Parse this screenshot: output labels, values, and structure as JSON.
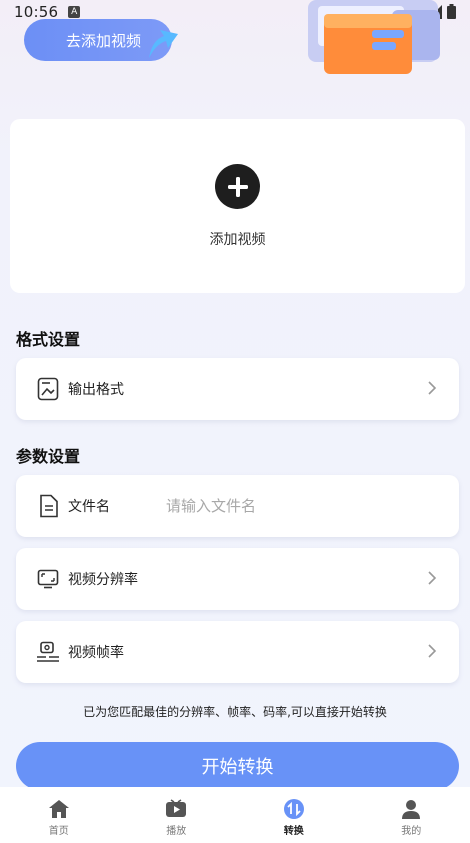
{
  "status_bar": {
    "time": "10:56",
    "badge": "A"
  },
  "hero": {
    "button_label": "去添加视频"
  },
  "upload": {
    "label": "添加视频"
  },
  "format_section": {
    "title": "格式设置",
    "output_format_label": "输出格式"
  },
  "param_section": {
    "title": "参数设置",
    "filename_label": "文件名",
    "filename_placeholder": "请输入文件名",
    "resolution_label": "视频分辨率",
    "framerate_label": "视频帧率"
  },
  "note": "已为您匹配最佳的分辨率、帧率、码率,可以直接开始转换",
  "start_button": "开始转换",
  "nav": {
    "items": [
      {
        "label": "首页",
        "icon": "home-icon"
      },
      {
        "label": "播放",
        "icon": "play-icon"
      },
      {
        "label": "转换",
        "icon": "convert-icon",
        "active": true
      },
      {
        "label": "我的",
        "icon": "profile-icon"
      }
    ]
  },
  "colors": {
    "accent": "#6892f7",
    "hero_button": "#6c8ff5",
    "active_nav": "#6892f7"
  }
}
